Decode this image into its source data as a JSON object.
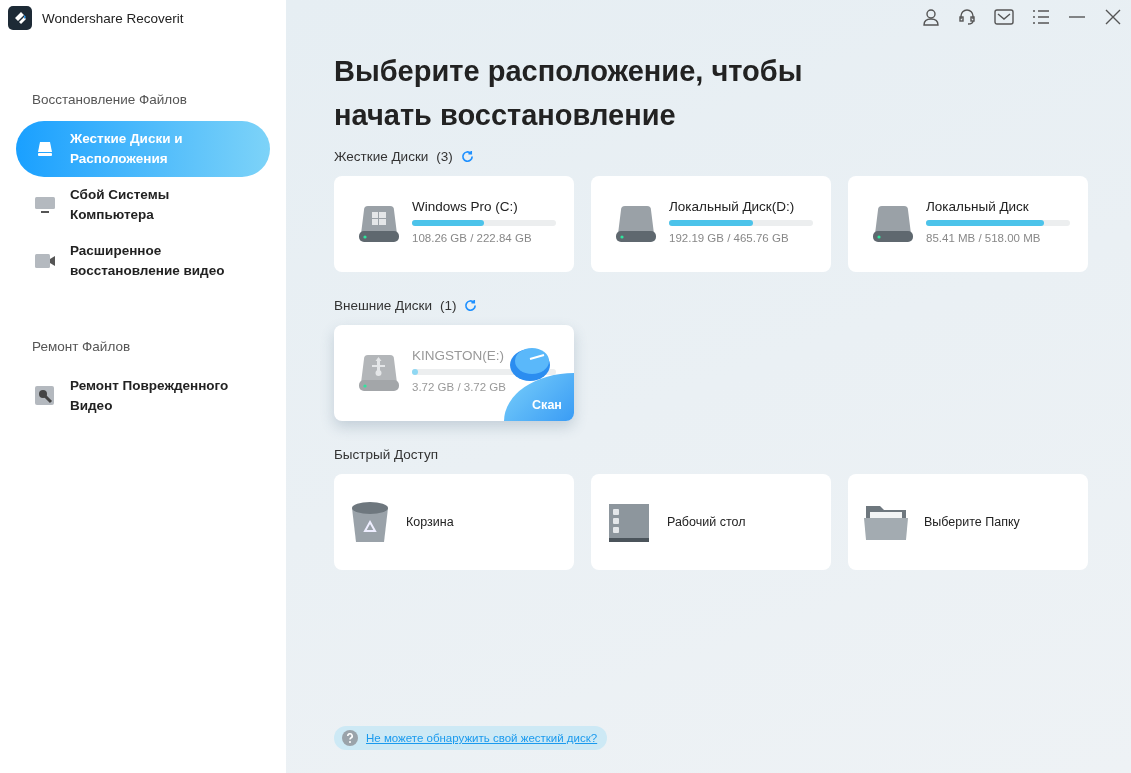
{
  "app": {
    "title": "Wondershare Recoverit"
  },
  "sidebar": {
    "sections": [
      {
        "heading": "Восстановление Файлов",
        "items": [
          {
            "label": "Жесткие Диски и Расположения",
            "kind": "drive",
            "selected": true
          },
          {
            "label": "Сбой Системы Компьютера",
            "kind": "monitor",
            "selected": false
          },
          {
            "label": "Расширенное восстановление видео",
            "kind": "camera",
            "selected": false
          }
        ]
      },
      {
        "heading": "Ремонт Файлов",
        "items": [
          {
            "label": "Ремонт Поврежденного Видео",
            "kind": "repair",
            "selected": false
          }
        ]
      }
    ]
  },
  "main": {
    "title": "Выберите расположение, чтобы начать восстановление",
    "hard_disks": {
      "label": "Жесткие Диски",
      "count": "(3)",
      "drives": [
        {
          "name": "Windows Pro (C:)",
          "usage": "108.26 GB / 222.84 GB",
          "level": 0.5,
          "kind": "windows",
          "hovered": false
        },
        {
          "name": "Локальный Диск(D:)",
          "usage": "192.19 GB / 465.76 GB",
          "level": 0.58,
          "kind": "plain",
          "hovered": false
        },
        {
          "name": "Локальный Диск",
          "usage": "85.41 MB / 518.00 MB",
          "level": 0.82,
          "kind": "plain",
          "hovered": false
        }
      ]
    },
    "external_disks": {
      "label": "Внешние Диски",
      "count": "(1)",
      "drives": [
        {
          "name": "KINGSTON(E:)",
          "usage": "3.72 GB / 3.72 GB",
          "level": 0.04,
          "kind": "usb",
          "hovered": true
        }
      ]
    },
    "scan_button": "Скан",
    "quick_access": {
      "label": "Быстрый Доступ",
      "items": [
        {
          "label": "Корзина",
          "kind": "trash"
        },
        {
          "label": "Рабочий стол",
          "kind": "desktop"
        },
        {
          "label": "Выберите Папку",
          "kind": "folder"
        }
      ]
    },
    "help_link": "Не можете обнаружить свой жесткий диск?"
  }
}
